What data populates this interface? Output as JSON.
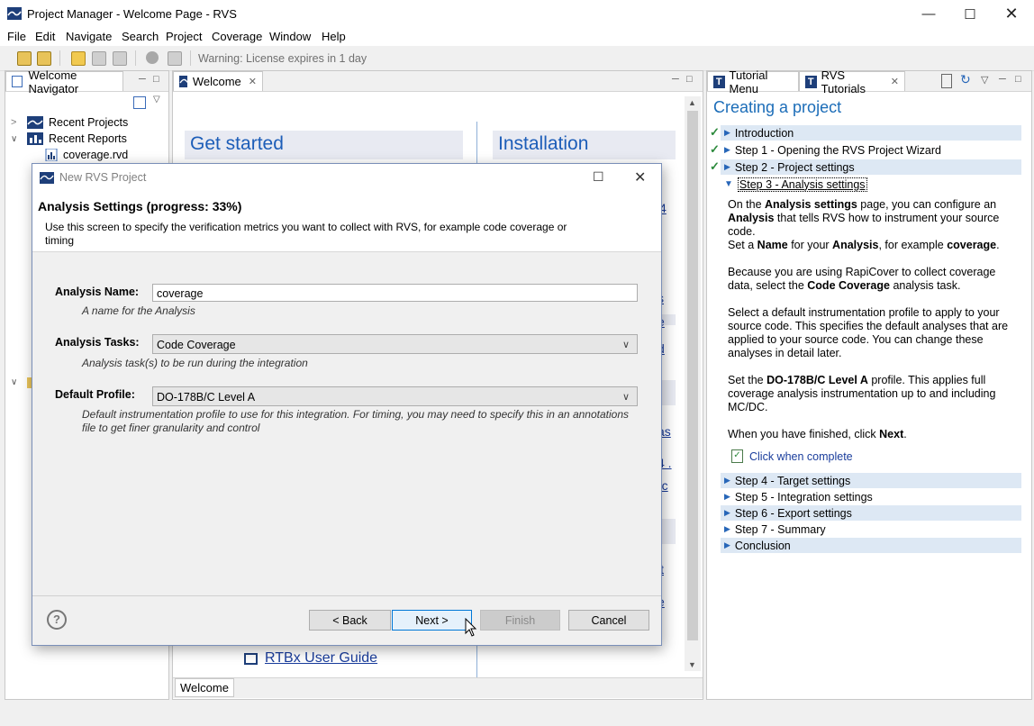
{
  "window": {
    "title": "Project Manager - Welcome Page - RVS"
  },
  "menu": [
    "File",
    "Edit",
    "Navigate",
    "Search",
    "Project",
    "Coverage",
    "Window",
    "Help"
  ],
  "toolbar": {
    "warning": "Warning: License expires in 1 day"
  },
  "navigator": {
    "tab_label": "Welcome Navigator",
    "items": {
      "recent_projects": "Recent Projects",
      "recent_reports": "Recent Reports",
      "coverage_file": "coverage.rvd"
    }
  },
  "welcome": {
    "tab_label": "Welcome",
    "get_started": "Get started",
    "installation": "Installation",
    "rtbx_link": "RTBx User Guide",
    "bottom_tab": "Welcome",
    "partial_links": [
      "4",
      "s",
      "e",
      "d",
      "as",
      "4 .",
      "-c",
      "it",
      "e"
    ]
  },
  "dialog": {
    "title": "New RVS Project",
    "heading": "Analysis Settings (progress: 33%)",
    "description": "Use this screen to specify the verification metrics you want to collect with RVS, for example code coverage or timing",
    "analysis_name": {
      "label": "Analysis Name:",
      "value": "coverage",
      "hint": "A name for the Analysis"
    },
    "analysis_tasks": {
      "label": "Analysis Tasks:",
      "value": "Code Coverage",
      "hint": "Analysis task(s) to be run during the integration"
    },
    "default_profile": {
      "label": "Default Profile:",
      "value": "DO-178B/C Level A",
      "hint": "Default instrumentation profile to use for this integration. For timing, you may need to specify this in an annotations file to get finer granularity and control"
    },
    "buttons": {
      "back": "< Back",
      "next": "Next >",
      "finish": "Finish",
      "cancel": "Cancel"
    }
  },
  "tutorial": {
    "tab_menu": "Tutorial Menu",
    "tab_rvs": "RVS Tutorials",
    "title": "Creating a project",
    "done_steps": [
      "Introduction",
      "Step 1 - Opening the RVS Project Wizard",
      "Step 2 - Project settings"
    ],
    "current_step": "Step 3 - Analysis settings",
    "para1_a": "On the ",
    "para1_b": "Analysis settings",
    "para1_c": " page, you can configure an ",
    "para1_d": "Analysis",
    "para1_e": " that tells RVS how to instrument your source code.",
    "para2_a": "Set a ",
    "para2_b": "Name",
    "para2_c": " for your ",
    "para2_d": "Analysis",
    "para2_e": ", for example ",
    "para2_f": "coverage",
    "para2_g": ".",
    "para3_a": "Because you are using RapiCover to collect coverage data, select the ",
    "para3_b": "Code Coverage",
    "para3_c": " analysis task.",
    "para4": "Select a default instrumentation profile to apply to your source code. This specifies the default analyses that are applied to your source code. You can change these analyses in detail later.",
    "para5_a": "Set the ",
    "para5_b": "DO-178B/C Level A",
    "para5_c": " profile. This applies full coverage analysis instrumentation up to and including MC/DC.",
    "para6_a": "When you have finished, click ",
    "para6_b": "Next",
    "para6_c": ".",
    "click_complete": "Click when complete",
    "next_steps": [
      "Step 4 - Target settings",
      "Step 5 - Integration settings",
      "Step 6 - Export settings",
      "Step 7 - Summary",
      "Conclusion"
    ]
  }
}
